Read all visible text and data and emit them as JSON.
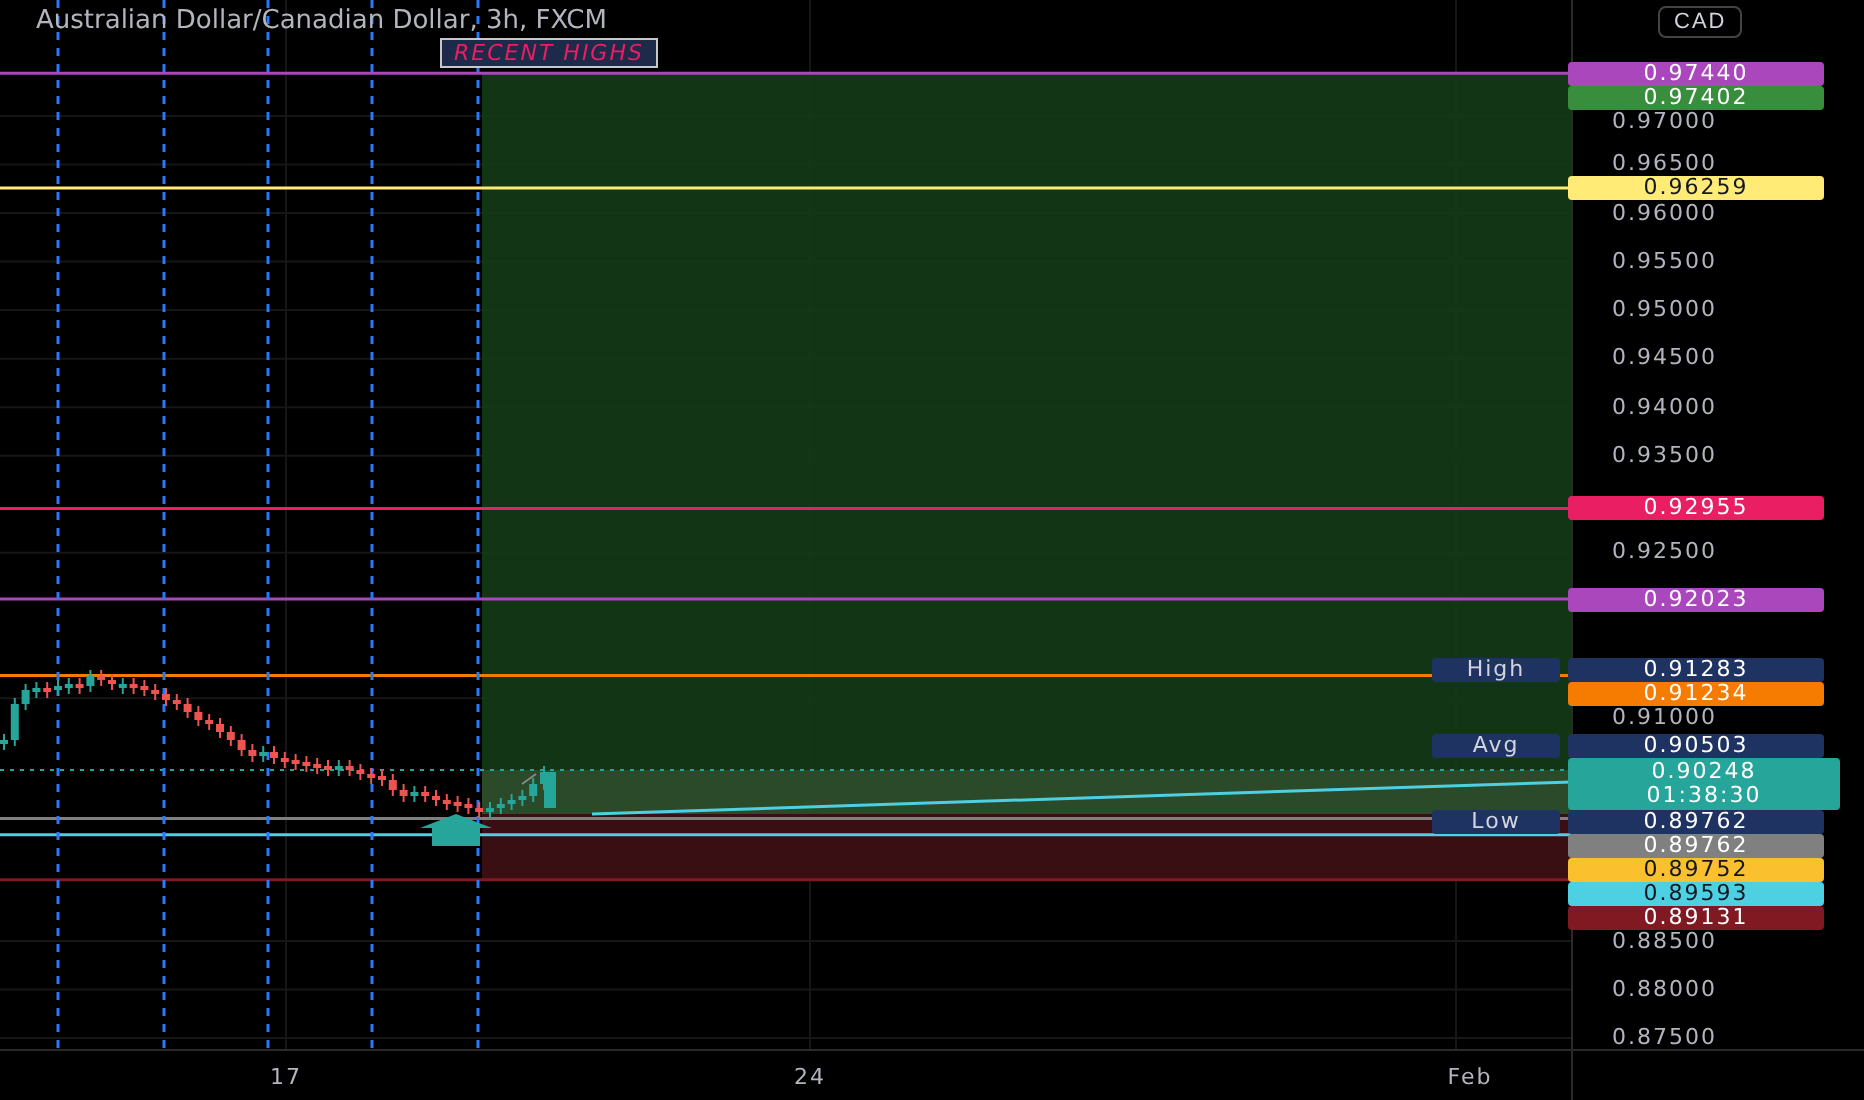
{
  "chart": {
    "title": "Australian Dollar/Canadian Dollar, 3h, FXCM",
    "annotation": "RECENT HIGHS",
    "currency_button": "CAD",
    "price_ticks": [
      "0.97000",
      "0.96500",
      "0.96000",
      "0.95500",
      "0.95000",
      "0.94500",
      "0.94000",
      "0.93500",
      "0.92500",
      "0.91000",
      "0.88500",
      "0.88000",
      "0.87500"
    ],
    "time_ticks": [
      "17",
      "24",
      "Feb"
    ],
    "price_tags": [
      {
        "kind": "level",
        "text": "0.97440",
        "color": "#ab47bc"
      },
      {
        "kind": "level",
        "text": "0.97402",
        "color": "#388e3c"
      },
      {
        "kind": "level",
        "text": "0.96259",
        "color": "#ffeb75"
      },
      {
        "kind": "level",
        "text": "0.92955",
        "color": "#e91e63"
      },
      {
        "kind": "level",
        "text": "0.92023",
        "color": "#ab47bc"
      },
      {
        "kind": "stat",
        "label": "High",
        "text": "0.91283",
        "color": "#1e3361"
      },
      {
        "kind": "level",
        "text": "0.91234",
        "color": "#f57c00"
      },
      {
        "kind": "stat",
        "label": "Avg",
        "text": "0.90503",
        "color": "#1e3361"
      },
      {
        "kind": "last",
        "text": "0.90248",
        "countdown": "01:38:30",
        "color": "#26a69a"
      },
      {
        "kind": "stat",
        "label": "Low",
        "text": "0.89762",
        "color": "#1e3361"
      },
      {
        "kind": "level",
        "text": "0.89762",
        "color": "#808080"
      },
      {
        "kind": "level",
        "text": "0.89752",
        "color": "#fbc02d"
      },
      {
        "kind": "level",
        "text": "0.89593",
        "color": "#4dd0e1"
      },
      {
        "kind": "level",
        "text": "0.89131",
        "color": "#801922"
      }
    ]
  }
}
